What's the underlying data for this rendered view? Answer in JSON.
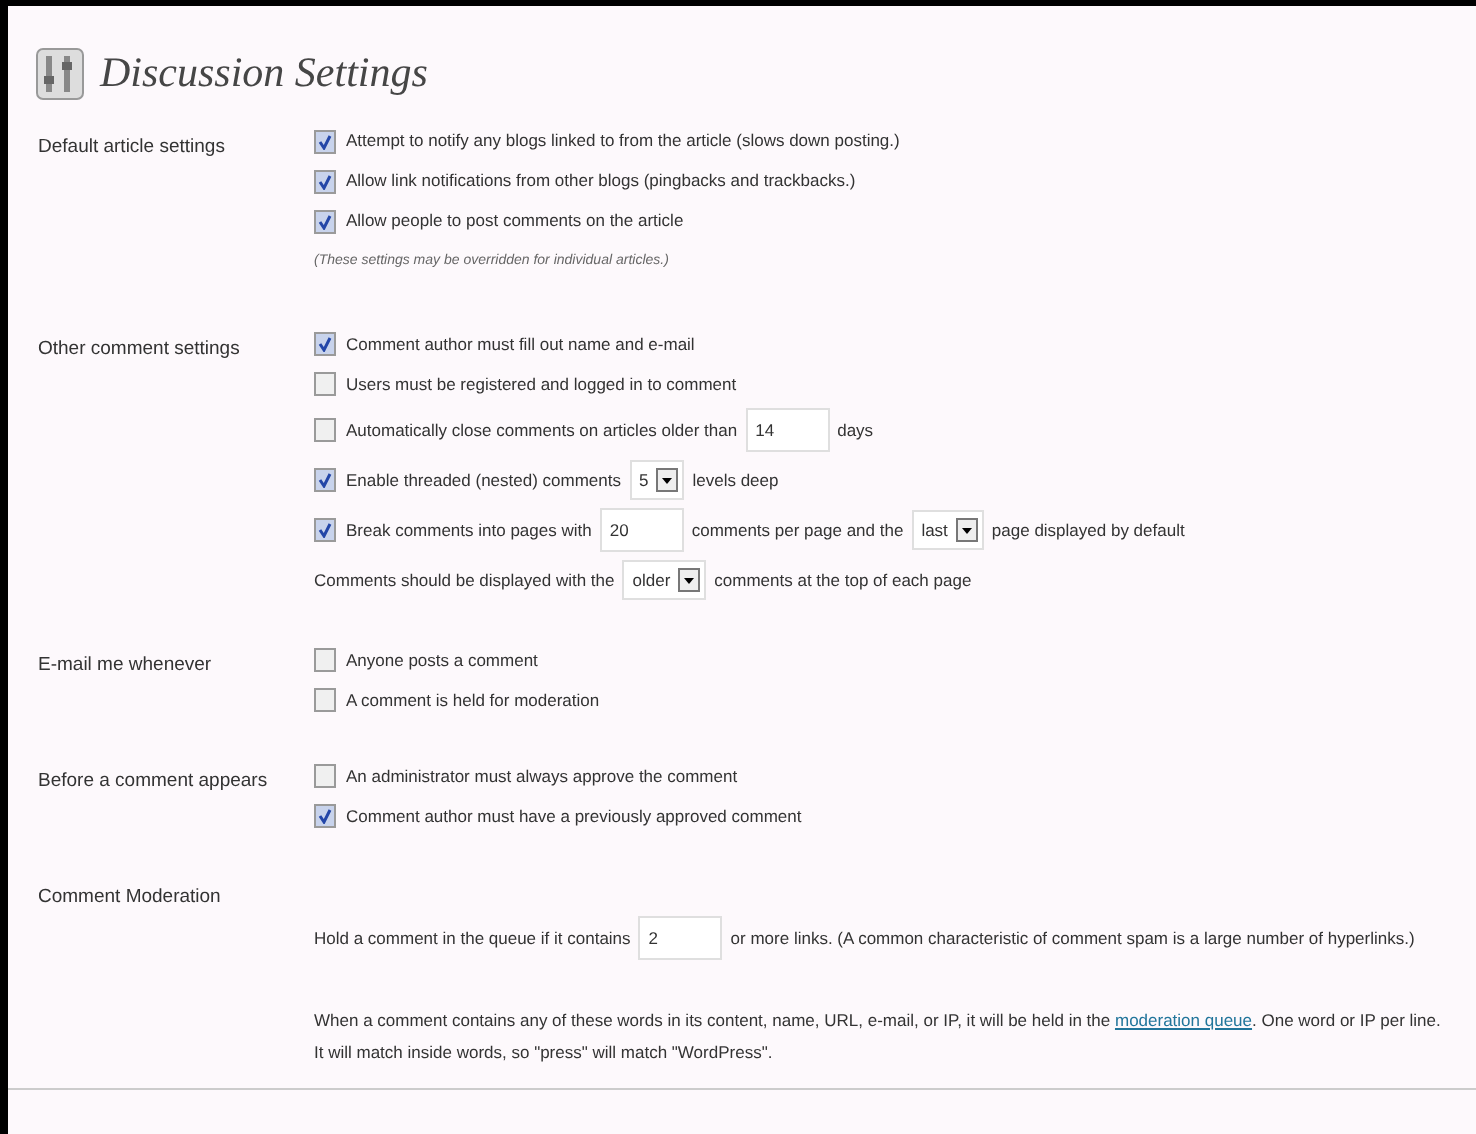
{
  "title": "Discussion Settings",
  "sections": [
    {
      "label": "Default article settings",
      "items": [
        {
          "kind": "checkbox",
          "checked": true,
          "parts": [
            {
              "kind": "text",
              "text": "Attempt to notify any blogs linked to from the article (slows down posting.)"
            }
          ]
        },
        {
          "kind": "checkbox",
          "checked": true,
          "parts": [
            {
              "kind": "text",
              "text": "Allow link notifications from other blogs (pingbacks and trackbacks.)"
            }
          ]
        },
        {
          "kind": "checkbox",
          "checked": true,
          "parts": [
            {
              "kind": "text",
              "text": "Allow people to post comments on the article"
            }
          ]
        },
        {
          "kind": "note",
          "text": "(These settings may be overridden for individual articles.)"
        }
      ]
    },
    {
      "label": "Other comment settings",
      "items": [
        {
          "kind": "checkbox",
          "checked": true,
          "parts": [
            {
              "kind": "text",
              "text": "Comment author must fill out name and e-mail"
            }
          ]
        },
        {
          "kind": "checkbox",
          "checked": false,
          "parts": [
            {
              "kind": "text",
              "text": "Users must be registered and logged in to comment"
            }
          ]
        },
        {
          "kind": "checkbox",
          "checked": false,
          "parts": [
            {
              "kind": "text",
              "text": "Automatically close comments on articles older than"
            },
            {
              "kind": "input",
              "value": "14"
            },
            {
              "kind": "text",
              "text": "days"
            }
          ]
        },
        {
          "kind": "checkbox",
          "checked": true,
          "parts": [
            {
              "kind": "text",
              "text": "Enable threaded (nested) comments"
            },
            {
              "kind": "select",
              "value": "5"
            },
            {
              "kind": "text",
              "text": "levels deep"
            }
          ]
        },
        {
          "kind": "checkbox",
          "checked": true,
          "parts": [
            {
              "kind": "text",
              "text": "Break comments into pages with"
            },
            {
              "kind": "input",
              "value": "20"
            },
            {
              "kind": "text",
              "text": "comments per page and the"
            },
            {
              "kind": "select",
              "value": "last"
            },
            {
              "kind": "text",
              "text": "page displayed by default"
            }
          ]
        },
        {
          "kind": "line",
          "parts": [
            {
              "kind": "text",
              "text": "Comments should be displayed with the"
            },
            {
              "kind": "select",
              "value": "older"
            },
            {
              "kind": "text",
              "text": "comments at the top of each page"
            }
          ]
        }
      ]
    },
    {
      "label": "E-mail me whenever",
      "items": [
        {
          "kind": "checkbox",
          "checked": false,
          "parts": [
            {
              "kind": "text",
              "text": "Anyone posts a comment"
            }
          ]
        },
        {
          "kind": "checkbox",
          "checked": false,
          "parts": [
            {
              "kind": "text",
              "text": "A comment is held for moderation"
            }
          ]
        }
      ]
    },
    {
      "label": "Before a comment appears",
      "items": [
        {
          "kind": "checkbox",
          "checked": false,
          "parts": [
            {
              "kind": "text",
              "text": "An administrator must always approve the comment"
            }
          ]
        },
        {
          "kind": "checkbox",
          "checked": true,
          "parts": [
            {
              "kind": "text",
              "text": "Comment author must have a previously approved comment"
            }
          ]
        }
      ]
    },
    {
      "label": "Comment Moderation",
      "items": [
        {
          "kind": "line",
          "parts": [
            {
              "kind": "text",
              "text": "Hold a comment in the queue if it contains"
            },
            {
              "kind": "input",
              "value": "2"
            },
            {
              "kind": "text",
              "text": "or more links. (A common characteristic of comment spam is a large number of hyperlinks.)"
            }
          ]
        },
        {
          "kind": "paragraph",
          "parts": [
            {
              "kind": "text",
              "text": "When a comment contains any of these words in its content, name, URL, e-mail, or IP, it will be held in the "
            },
            {
              "kind": "link",
              "text": "moderation queue"
            },
            {
              "kind": "text",
              "text": ". One word or IP per line. It will match inside words, so \"press\" will match \"WordPress\"."
            }
          ]
        }
      ]
    }
  ]
}
